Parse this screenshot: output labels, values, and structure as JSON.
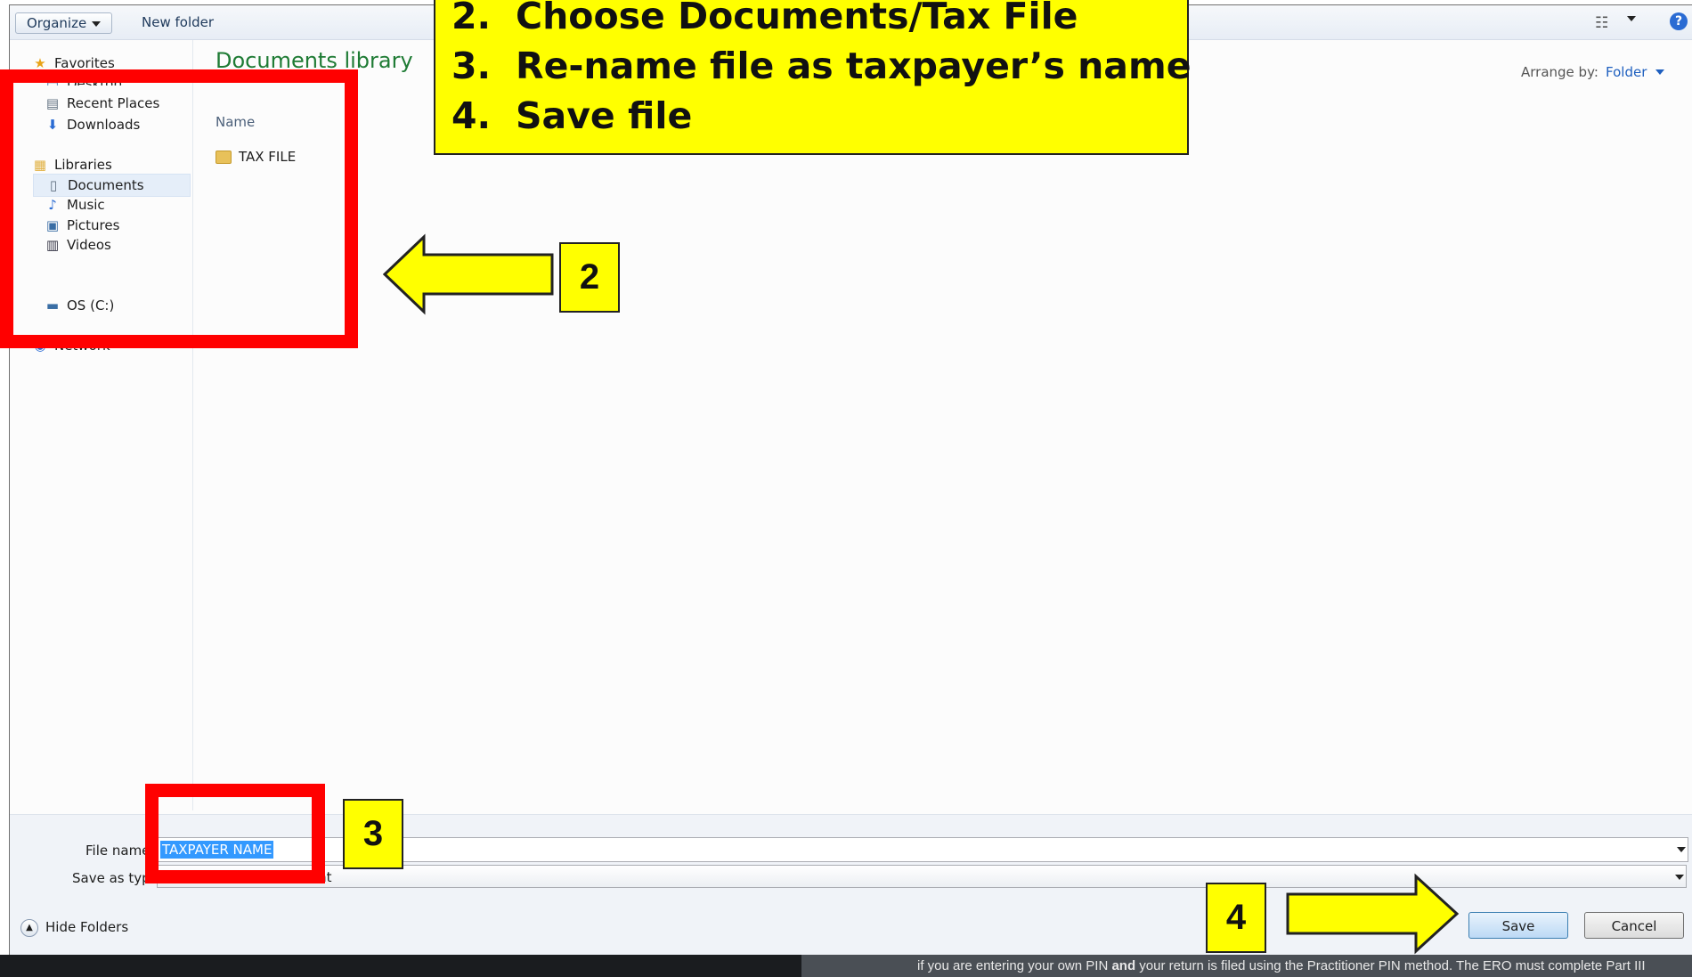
{
  "toolbar": {
    "organize_label": "Organize",
    "new_folder_label": "New folder"
  },
  "nav": {
    "favorites": "Favorites",
    "desktop": "Desktop",
    "recent_places": "Recent Places",
    "downloads": "Downloads",
    "libraries": "Libraries",
    "documents": "Documents",
    "music": "Music",
    "pictures": "Pictures",
    "videos": "Videos",
    "drive": "OS (C:)",
    "network": "Network"
  },
  "main": {
    "title": "Documents library",
    "arrange_label": "Arrange by:",
    "arrange_value": "Folder",
    "column_name": "Name",
    "files": [
      "TAX FILE"
    ]
  },
  "form": {
    "file_name_label": "File name:",
    "file_name_value": "TAXPAYER NAME",
    "save_type_label": "Save as type:",
    "save_type_value": "Adobe Acrobat Document"
  },
  "buttons": {
    "hide_folders": "Hide Folders",
    "save": "Save",
    "cancel": "Cancel"
  },
  "callout": {
    "step2_num": "2.",
    "step2_text": "Choose Documents/Tax File",
    "step3_num": "3.",
    "step3_text": "Re-name file as taxpayer’s name",
    "step4_num": "4.",
    "step4_text": "Save file"
  },
  "markers": {
    "m2": "2",
    "m3": "3",
    "m4": "4"
  },
  "footer": {
    "text_before": "if you are entering your own PIN ",
    "text_bold": "and",
    "text_after": " your return is filed using the Practitioner PIN method. The ERO must complete Part III"
  },
  "colors": {
    "callout_yellow": "#ffff00",
    "highlight_red": "#ff0000",
    "library_title_green": "#1e7b34",
    "selection_blue": "#3399ff"
  }
}
